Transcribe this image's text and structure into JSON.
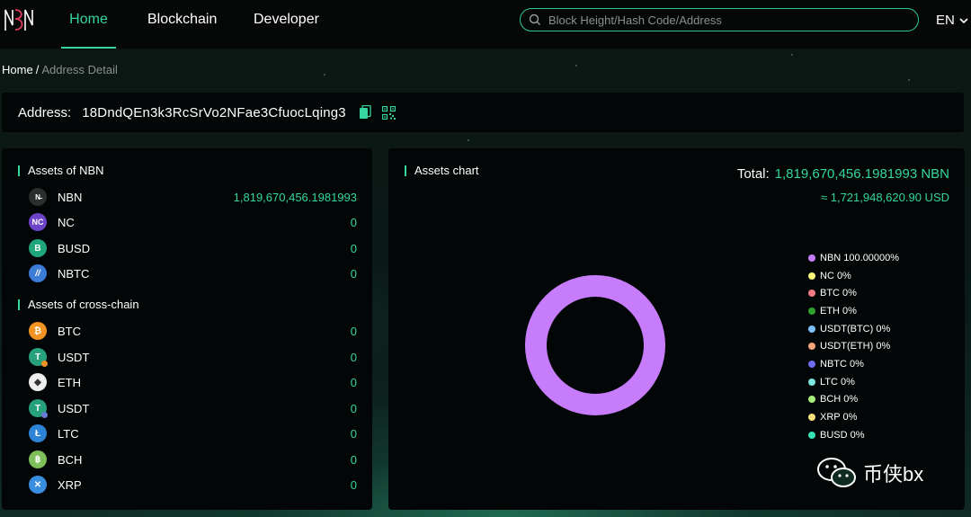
{
  "nav": {
    "items": [
      {
        "label": "Home",
        "active": true
      },
      {
        "label": "Blockchain",
        "active": false
      },
      {
        "label": "Developer",
        "active": false
      }
    ],
    "search_placeholder": "Block Height/Hash Code/Address",
    "language": "EN"
  },
  "breadcrumb": {
    "home": "Home",
    "separator": "/",
    "current": "Address Detail"
  },
  "address": {
    "label": "Address:",
    "value": "18DndQEn3k3RcSrVo2NFae3CfuocLqing3"
  },
  "nbn_assets": {
    "title": "Assets of NBN",
    "items": [
      {
        "name": "NBN",
        "value": "1,819,670,456.1981993",
        "icon": "nbn-icon",
        "color": "#2a2e2d"
      },
      {
        "name": "NC",
        "value": "0",
        "icon": "nc-icon",
        "color": "#6c43c9"
      },
      {
        "name": "BUSD",
        "value": "0",
        "icon": "busd-icon",
        "color": "#1fa67a"
      },
      {
        "name": "NBTC",
        "value": "0",
        "icon": "nbtc-icon",
        "color": "#3c7bd6"
      }
    ]
  },
  "cross_chain_assets": {
    "title": "Assets of cross-chain",
    "items": [
      {
        "name": "BTC",
        "value": "0",
        "icon": "btc-icon",
        "color": "#f39321"
      },
      {
        "name": "USDT",
        "value": "0",
        "icon": "usdt-icon",
        "color": "#26a17b"
      },
      {
        "name": "ETH",
        "value": "0",
        "icon": "eth-icon",
        "color": "#eeeeee"
      },
      {
        "name": "USDT",
        "value": "0",
        "icon": "usdt-icon",
        "color": "#26a17b"
      },
      {
        "name": "LTC",
        "value": "0",
        "icon": "ltc-icon",
        "color": "#2d83d6"
      },
      {
        "name": "BCH",
        "value": "0",
        "icon": "bch-icon",
        "color": "#7fbf5a"
      },
      {
        "name": "XRP",
        "value": "0",
        "icon": "xrp-icon",
        "color": "#3a8ee0"
      }
    ]
  },
  "chart": {
    "title": "Assets chart",
    "total_label": "Total:",
    "total_value": "1,819,670,456.1981993 NBN",
    "usd_value": "≈ 1,721,948,620.90 USD"
  },
  "chart_data": {
    "type": "pie",
    "donut": true,
    "title": "Assets chart",
    "categories": [
      "NBN",
      "NC",
      "BTC",
      "ETH",
      "USDT(BTC)",
      "USDT(ETH)",
      "NBTC",
      "LTC",
      "BCH",
      "XRP",
      "BUSD"
    ],
    "values": [
      100,
      0,
      0,
      0,
      0,
      0,
      0,
      0,
      0,
      0,
      0
    ],
    "legend_labels": [
      "NBN 100.00000%",
      "NC 0%",
      "BTC 0%",
      "ETH 0%",
      "USDT(BTC) 0%",
      "USDT(ETH) 0%",
      "NBTC 0%",
      "LTC 0%",
      "BCH 0%",
      "XRP 0%",
      "BUSD 0%"
    ],
    "colors": [
      "#c77dfb",
      "#f9f67a",
      "#f47a83",
      "#2ea12e",
      "#7ac1f9",
      "#f4a57a",
      "#6d6cf5",
      "#7be8e0",
      "#a6ed7a",
      "#f9e07a",
      "#37e3b2"
    ],
    "legend": "right"
  },
  "watermark": {
    "text": "币侠bx",
    "icon": "wechat-icon"
  },
  "colors": {
    "accent": "#35d6a0",
    "panel": "#030606"
  }
}
